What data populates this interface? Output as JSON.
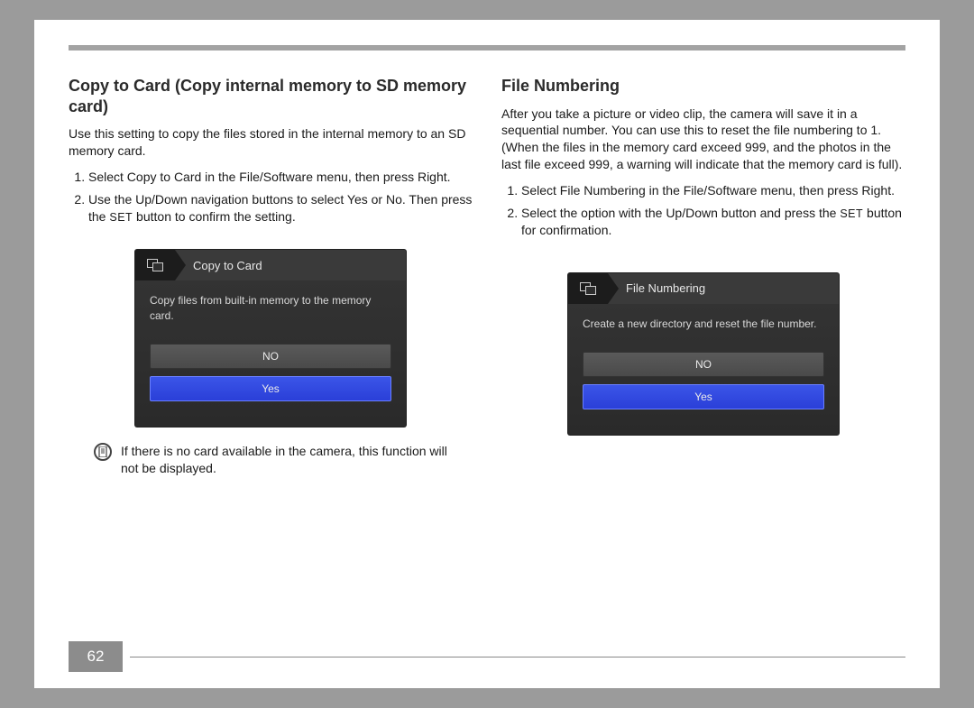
{
  "page_number": "62",
  "left": {
    "heading": "Copy to Card (Copy internal memory to SD memory card)",
    "desc": "Use this setting to copy the files stored in the internal memory to an SD memory card.",
    "step1": "Select Copy to Card in the File/Software menu, then press Right.",
    "step2_pre": "Use the Up/Down navigation buttons to select Yes or No. Then press the ",
    "step2_set": "SET",
    "step2_post": " button to confirm the setting.",
    "screen": {
      "title": "Copy to Card",
      "caption": "Copy files from built-in memory to the memory card.",
      "no": "NO",
      "yes": "Yes"
    },
    "note": "If there is no card available in the camera, this function will not be displayed."
  },
  "right": {
    "heading": "File Numbering",
    "desc": "After you take a picture or video clip, the camera will save it in a sequential number. You can use this to reset the file numbering to 1. (When the files in the memory card exceed 999, and the photos in the last file exceed 999, a warning will indicate that the memory card is full).",
    "step1": "Select File Numbering in the File/Software menu, then press Right.",
    "step2_pre": "Select the option with the Up/Down button and press the ",
    "step2_set": "SET",
    "step2_post": " button for confirmation.",
    "screen": {
      "title": "File Numbering",
      "caption": "Create a new directory and reset the file number.",
      "no": "NO",
      "yes": "Yes"
    }
  }
}
